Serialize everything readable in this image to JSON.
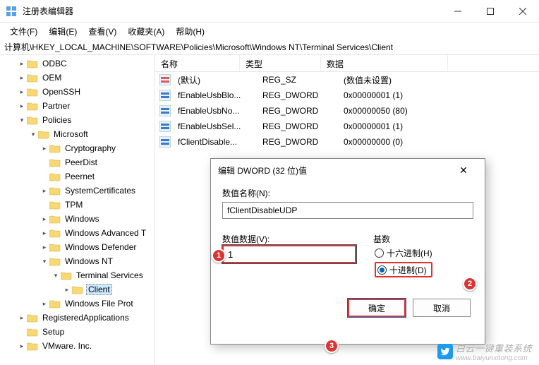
{
  "window": {
    "title": "注册表编辑器"
  },
  "menu": {
    "file": "文件(F)",
    "edit": "编辑(E)",
    "view": "查看(V)",
    "fav": "收藏夹(A)",
    "help": "帮助(H)"
  },
  "path": "计算机\\HKEY_LOCAL_MACHINE\\SOFTWARE\\Policies\\Microsoft\\Windows NT\\Terminal Services\\Client",
  "columns": {
    "name": "名称",
    "type": "类型",
    "data": "数据"
  },
  "rows": [
    {
      "icon": "sz",
      "name": "(默认)",
      "type": "REG_SZ",
      "data": "(数值未设置)"
    },
    {
      "icon": "dw",
      "name": "fEnableUsbBlo...",
      "type": "REG_DWORD",
      "data": "0x00000001 (1)"
    },
    {
      "icon": "dw",
      "name": "fEnableUsbNo...",
      "type": "REG_DWORD",
      "data": "0x00000050 (80)"
    },
    {
      "icon": "dw",
      "name": "fEnableUsbSel...",
      "type": "REG_DWORD",
      "data": "0x00000001 (1)"
    },
    {
      "icon": "dw",
      "name": "fClientDisable...",
      "type": "REG_DWORD",
      "data": "0x00000000 (0)"
    }
  ],
  "tree": [
    {
      "depth": 1,
      "caret": "r",
      "label": "ODBC"
    },
    {
      "depth": 1,
      "caret": "r",
      "label": "OEM"
    },
    {
      "depth": 1,
      "caret": "r",
      "label": "OpenSSH"
    },
    {
      "depth": 1,
      "caret": "r",
      "label": "Partner"
    },
    {
      "depth": 1,
      "caret": "d",
      "label": "Policies"
    },
    {
      "depth": 2,
      "caret": "d",
      "label": "Microsoft"
    },
    {
      "depth": 3,
      "caret": "r",
      "label": "Cryptography"
    },
    {
      "depth": 3,
      "caret": "",
      "label": "PeerDist"
    },
    {
      "depth": 3,
      "caret": "",
      "label": "Peernet"
    },
    {
      "depth": 3,
      "caret": "r",
      "label": "SystemCertificates"
    },
    {
      "depth": 3,
      "caret": "",
      "label": "TPM"
    },
    {
      "depth": 3,
      "caret": "r",
      "label": "Windows"
    },
    {
      "depth": 3,
      "caret": "r",
      "label": "Windows Advanced T"
    },
    {
      "depth": 3,
      "caret": "r",
      "label": "Windows Defender"
    },
    {
      "depth": 3,
      "caret": "d",
      "label": "Windows NT"
    },
    {
      "depth": 4,
      "caret": "d",
      "label": "Terminal Services"
    },
    {
      "depth": 5,
      "caret": "r",
      "label": "Client",
      "selected": true
    },
    {
      "depth": 3,
      "caret": "r",
      "label": "Windows File Prot"
    },
    {
      "depth": 1,
      "caret": "r",
      "label": "RegisteredApplications"
    },
    {
      "depth": 1,
      "caret": "",
      "label": "Setup"
    },
    {
      "depth": 1,
      "caret": "r",
      "label": "VMware. Inc."
    }
  ],
  "dialog": {
    "title": "编辑 DWORD (32 位)值",
    "name_label": "数值名称(N):",
    "name_value": "fClientDisableUDP",
    "data_label": "数值数据(V):",
    "data_value": "1",
    "base_label": "基数",
    "radio_hex": "十六进制(H)",
    "radio_dec": "十进制(D)",
    "ok": "确定",
    "cancel": "取消"
  },
  "callouts": {
    "c1": "1",
    "c2": "2",
    "c3": "3"
  },
  "watermark": {
    "text": "白云一键重装系统",
    "url": "www.baiyunxitong.com"
  }
}
